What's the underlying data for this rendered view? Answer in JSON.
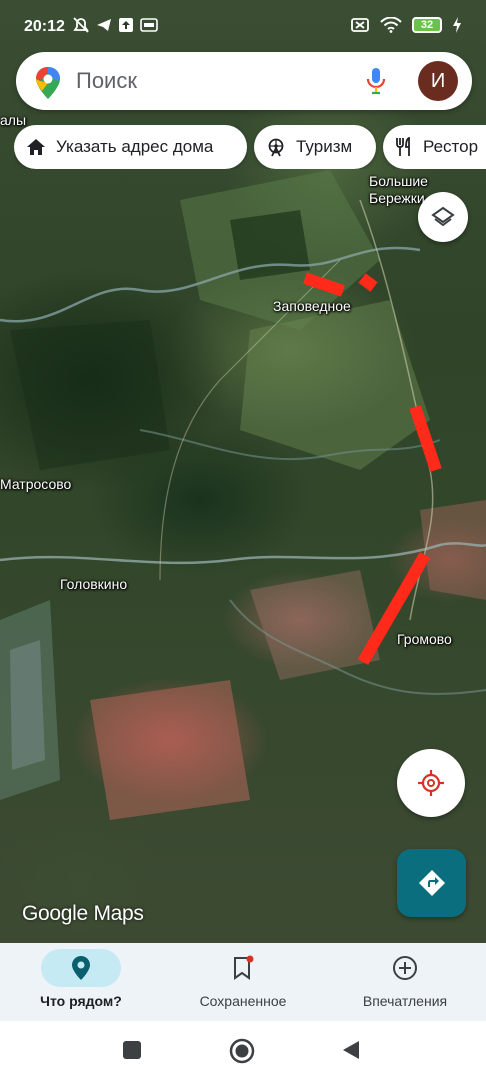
{
  "status_bar": {
    "time": "20:12",
    "battery": "32"
  },
  "search": {
    "placeholder": "Поиск",
    "avatar_letter": "И"
  },
  "chips": [
    {
      "label": "Указать адрес дома",
      "icon": "home-icon"
    },
    {
      "label": "Туризм",
      "icon": "ferris-wheel-icon"
    },
    {
      "label": "Рестор",
      "icon": "restaurant-icon"
    }
  ],
  "map": {
    "places": [
      {
        "name": "Заповедное"
      },
      {
        "name": "Большие"
      },
      {
        "name": "Бережки"
      },
      {
        "name": "Матросово"
      },
      {
        "name": "Головкино"
      },
      {
        "name": "Громово"
      },
      {
        "name": "алы"
      }
    ],
    "brand": "Google Maps",
    "accent_colors": {
      "route_marks": "#ff2a1a",
      "directions_button": "#0b6e7e"
    }
  },
  "bottom_nav": [
    {
      "label": "Что рядом?",
      "icon": "location-pin-icon",
      "active": true
    },
    {
      "label": "Сохраненное",
      "icon": "bookmark-icon",
      "active": false
    },
    {
      "label": "Впечатления",
      "icon": "add-circle-icon",
      "active": false
    }
  ]
}
